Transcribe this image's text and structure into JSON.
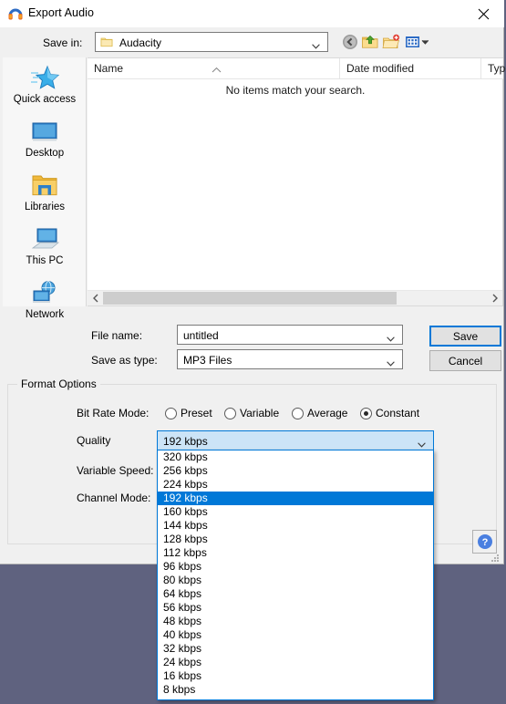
{
  "window": {
    "title": "Export Audio",
    "icon": "audacity-headphones-icon",
    "close_label": "✕"
  },
  "toolbar": {
    "save_in_label": "Save in:",
    "save_in_value": "Audacity",
    "buttons": [
      {
        "name": "back-button",
        "tooltip": "Back"
      },
      {
        "name": "up-one-level-button",
        "tooltip": "Up One Level"
      },
      {
        "name": "new-folder-button",
        "tooltip": "Create New Folder"
      },
      {
        "name": "views-button",
        "tooltip": "Views"
      }
    ]
  },
  "places": [
    {
      "label": "Quick access",
      "icon": "star-icon"
    },
    {
      "label": "Desktop",
      "icon": "monitor-icon"
    },
    {
      "label": "Libraries",
      "icon": "folder-icon"
    },
    {
      "label": "This PC",
      "icon": "computer-icon"
    },
    {
      "label": "Network",
      "icon": "network-globe-icon"
    }
  ],
  "filelist": {
    "columns": [
      "Name",
      "Date modified",
      "Type"
    ],
    "sort_column": "Name",
    "sort_direction": "ascending",
    "rows": [],
    "empty_message": "No items match your search."
  },
  "form": {
    "filename_label": "File name:",
    "filename_value": "untitled",
    "savetype_label": "Save as type:",
    "savetype_value": "MP3 Files",
    "save_button": "Save",
    "cancel_button": "Cancel"
  },
  "format_options": {
    "legend": "Format Options",
    "bitrate_mode_label": "Bit Rate Mode:",
    "bitrate_modes": [
      {
        "label": "Preset",
        "selected": false
      },
      {
        "label": "Variable",
        "selected": false
      },
      {
        "label": "Average",
        "selected": false
      },
      {
        "label": "Constant",
        "selected": true
      }
    ],
    "quality_label": "Quality",
    "quality_value": "192 kbps",
    "quality_open": true,
    "quality_options": [
      "320 kbps",
      "256 kbps",
      "224 kbps",
      "192 kbps",
      "160 kbps",
      "144 kbps",
      "128 kbps",
      "112 kbps",
      "96 kbps",
      "80 kbps",
      "64 kbps",
      "56 kbps",
      "48 kbps",
      "40 kbps",
      "32 kbps",
      "24 kbps",
      "16 kbps",
      "8 kbps"
    ],
    "variable_speed_label": "Variable Speed:",
    "channel_mode_label": "Channel Mode:"
  },
  "help": {
    "label": "?"
  },
  "colors": {
    "desktop": "#5f627f",
    "dialog_face": "#f0f0f0",
    "accent": "#0078d7",
    "combo_active": "#cce4f7",
    "folder_yellow": "#fbd56a"
  }
}
